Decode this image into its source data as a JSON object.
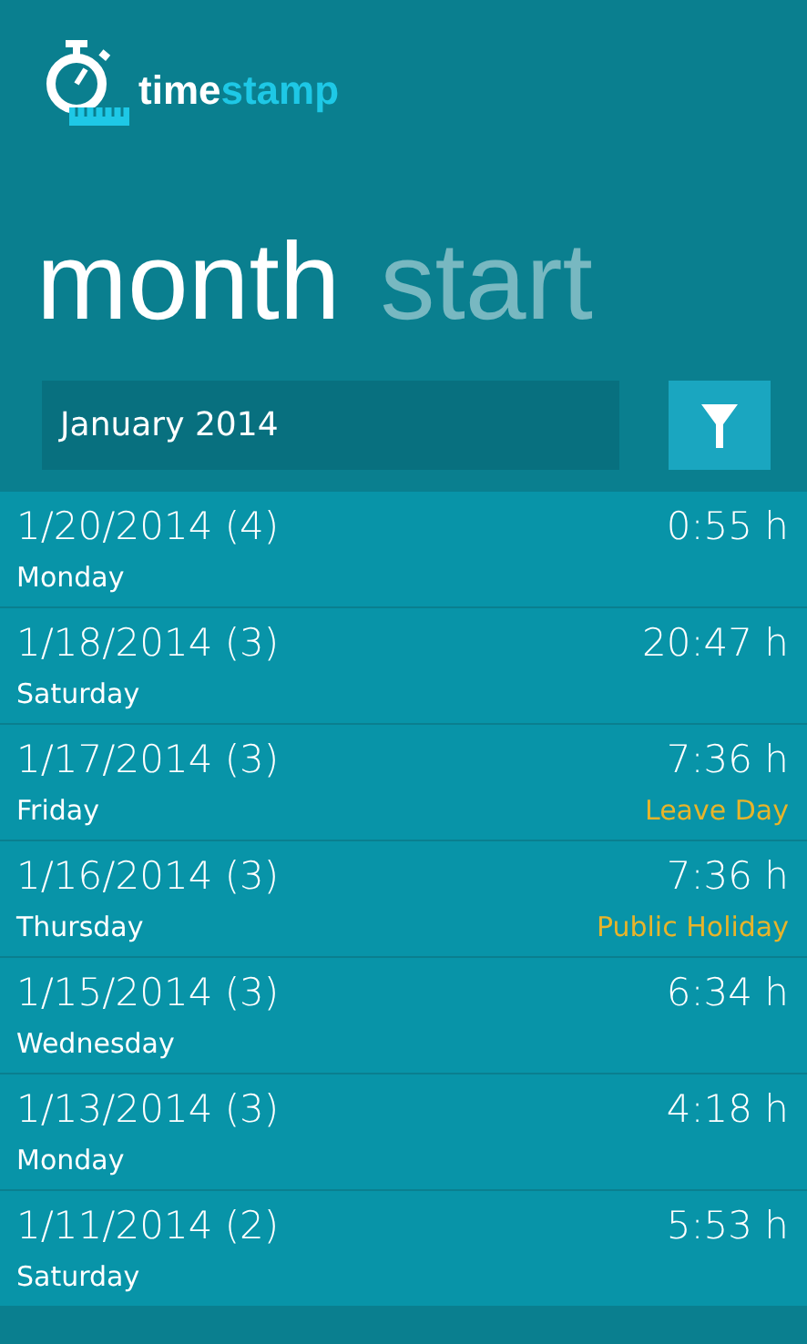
{
  "logo": {
    "word_1": "time",
    "word_2": "stamp"
  },
  "pivot": [
    {
      "label": "month",
      "selected": true
    },
    {
      "label": "start",
      "selected": false
    }
  ],
  "month_field": {
    "value": "January 2014"
  },
  "entries": [
    {
      "date": "1/20/2014 (4)",
      "day": "Monday",
      "duration": "0:55 h"
    },
    {
      "date": "1/18/2014 (3)",
      "day": "Saturday",
      "duration": "20:47 h"
    },
    {
      "date": "1/17/2014 (3)",
      "day": "Friday",
      "duration": "7:36 h",
      "note": "Leave Day"
    },
    {
      "date": "1/16/2014 (3)",
      "day": "Thursday",
      "duration": "7:36 h",
      "note": "Public Holiday"
    },
    {
      "date": "1/15/2014 (3)",
      "day": "Wednesday",
      "duration": "6:34 h"
    },
    {
      "date": "1/13/2014 (3)",
      "day": "Monday",
      "duration": "4:18 h"
    },
    {
      "date": "1/11/2014 (2)",
      "day": "Saturday",
      "duration": "5:53 h"
    }
  ]
}
